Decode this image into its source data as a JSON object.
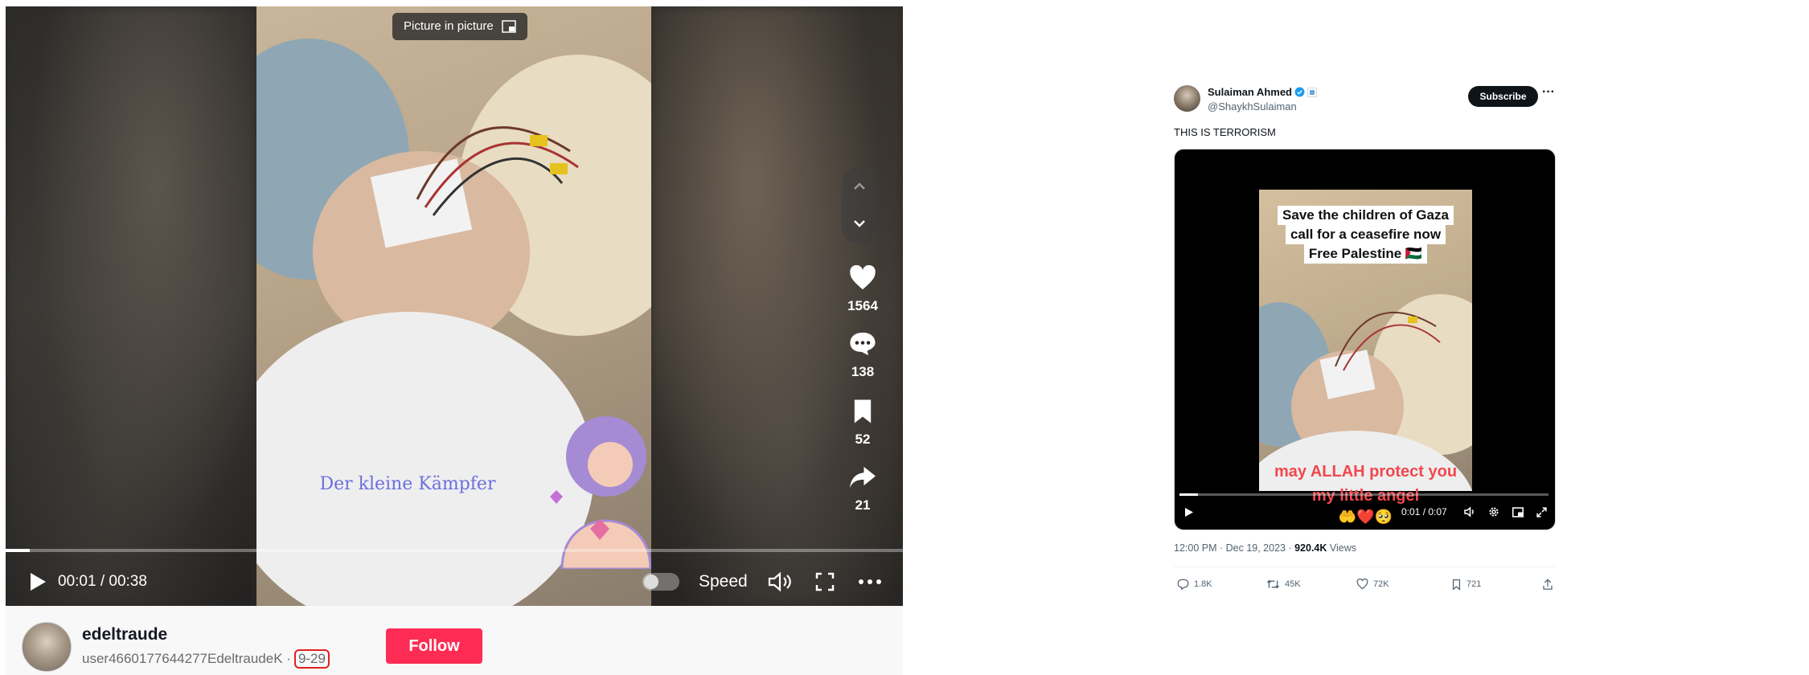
{
  "tiktok": {
    "pip_label": "Picture in picture",
    "video_caption": "Der kleine Kämpfer",
    "actions": {
      "likes": "1564",
      "comments": "138",
      "bookmarks": "52",
      "shares": "21"
    },
    "player": {
      "time": "00:01 / 00:38",
      "progress": 0.027,
      "speed_label": "Speed"
    },
    "author": {
      "name": "edeltraude",
      "username": "user4660177644277EdeltraudeK ·",
      "date": "9-29",
      "follow_label": "Follow"
    },
    "colors": {
      "follow": "#fe2c55",
      "date_highlight": "#e02020"
    }
  },
  "tweet": {
    "author_name": "Sulaiman Ahmed",
    "handle": "@ShaykhSulaiman",
    "subscribe_label": "Subscribe",
    "more_label": "···",
    "text": "THIS IS TERRORISM",
    "video_overlay_top": [
      "Save the children of Gaza",
      "call for a ceasefire now",
      "Free Palestine 🇵🇸"
    ],
    "video_overlay_bottom": [
      "may ALLAH protect you",
      "my little angel"
    ],
    "emoji_row": "🤲❤️🥺",
    "player": {
      "time": "0:01 / 0:07",
      "progress": 0.05
    },
    "meta": {
      "time_date": "12:00 PM · Dec 19, 2023 · ",
      "views_count": "920.4K",
      "views_label": " Views"
    },
    "stats": {
      "replies": "1.8K",
      "reposts": "45K",
      "likes": "72K",
      "bookmarks": "721"
    },
    "colors": {
      "verified": "#1d9bf0",
      "overlay_red": "#f0484e"
    }
  }
}
